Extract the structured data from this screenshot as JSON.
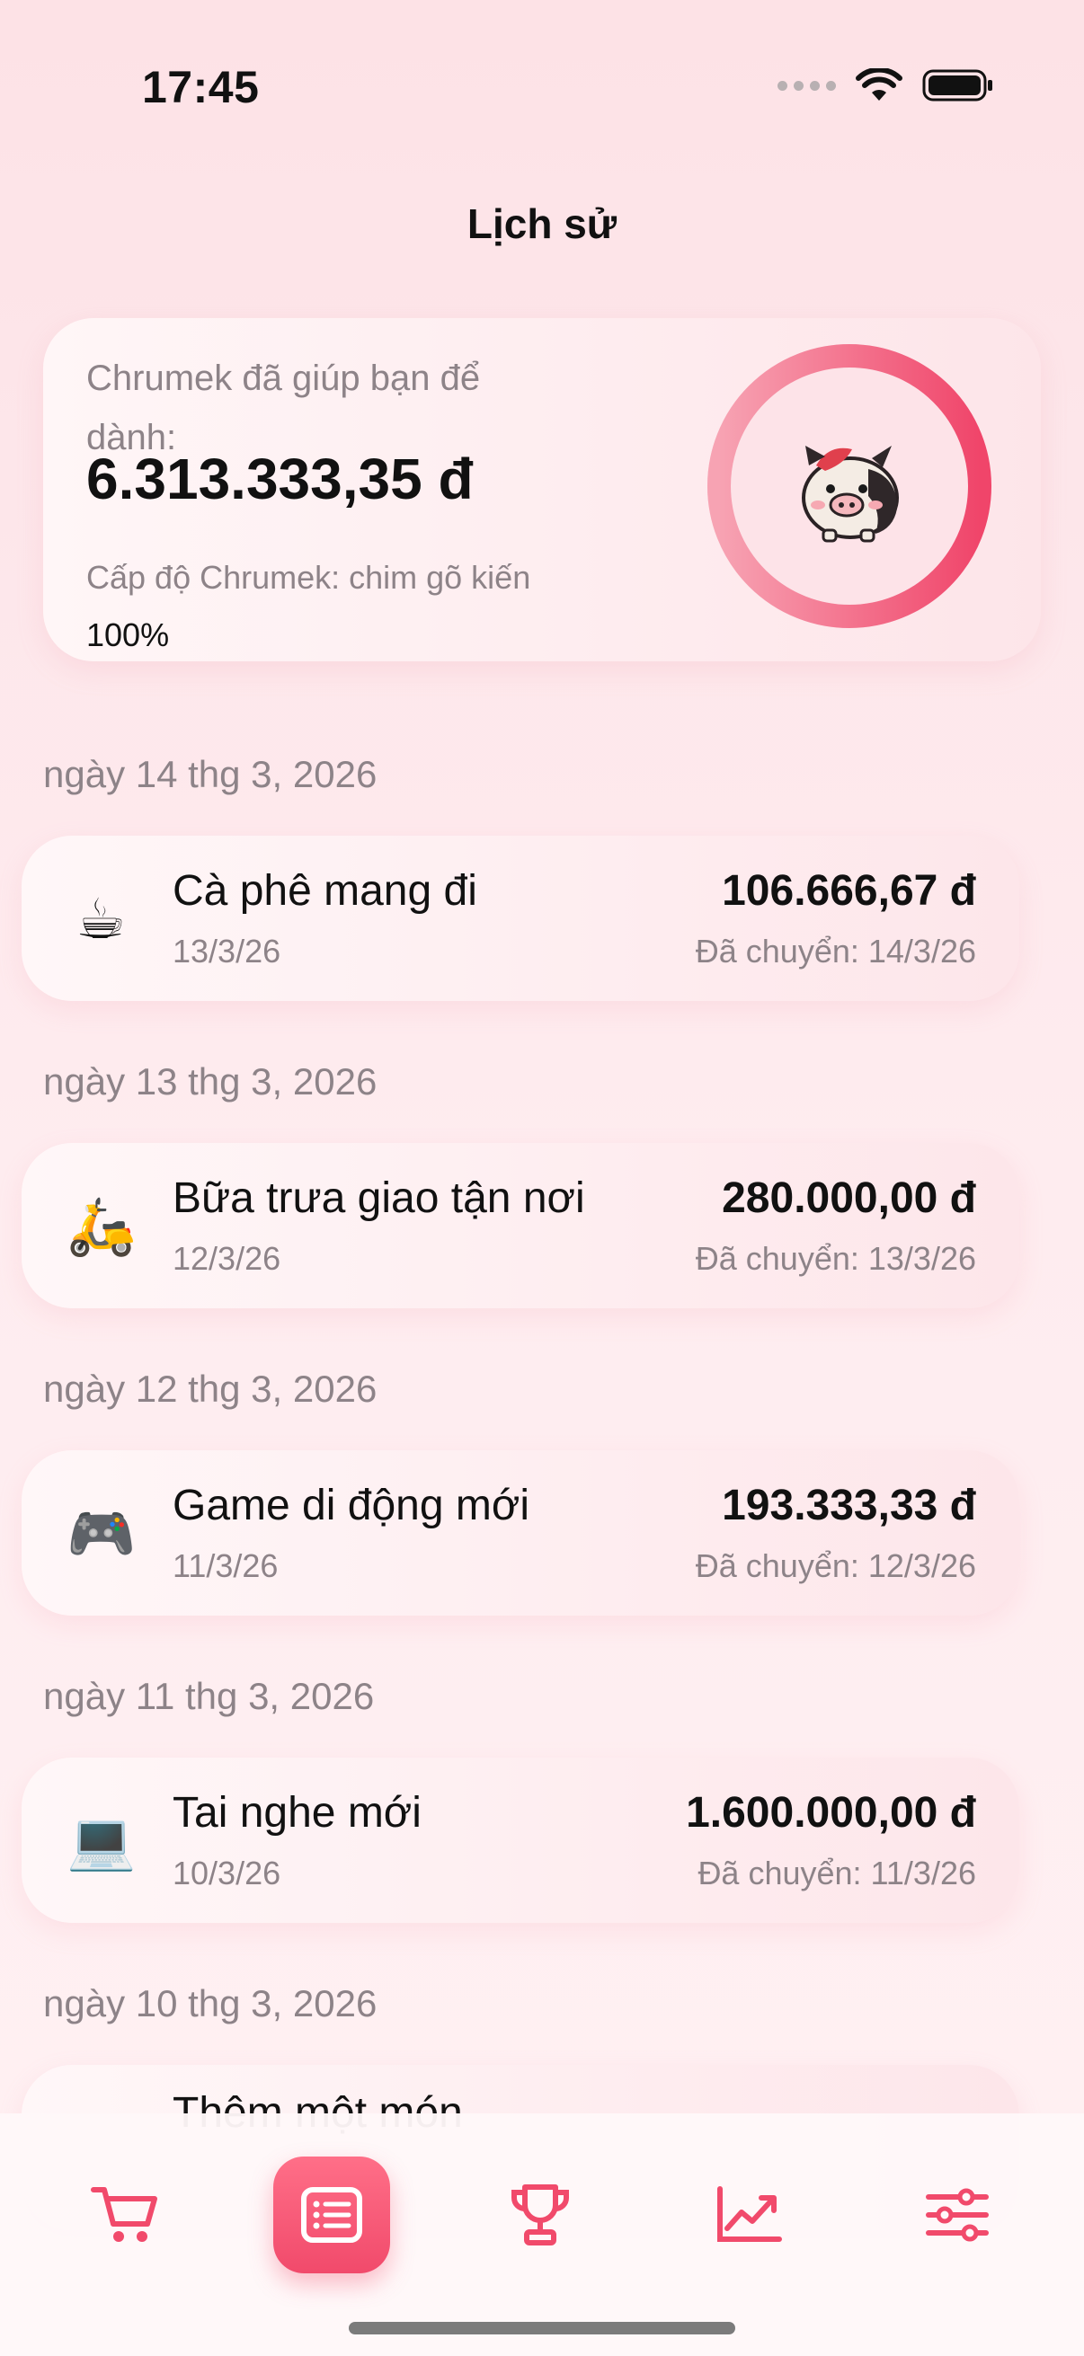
{
  "status_bar": {
    "time": "17:45"
  },
  "header": {
    "title": "Lịch sử"
  },
  "summary": {
    "caption": "Chrumek đã giúp bạn để dành:",
    "amount": "6.313.333,35 đ",
    "level": "Cấp độ Chrumek: chim gõ kiến",
    "percent": "100%",
    "progress": 1.0
  },
  "history": [
    {
      "date": "ngày 14 thg 3, 2026",
      "icon": "coffee-icon",
      "emoji": "☕",
      "title": "Cà phê mang đi",
      "created": "13/3/26",
      "amount": "106.666,67 đ",
      "transfer": "Đã chuyển: 14/3/26"
    },
    {
      "date": "ngày 13 thg 3, 2026",
      "icon": "scooter-icon",
      "emoji": "🛵",
      "title": "Bữa trưa giao tận nơi",
      "created": "12/3/26",
      "amount": "280.000,00 đ",
      "transfer": "Đã chuyển: 13/3/26"
    },
    {
      "date": "ngày 12 thg 3, 2026",
      "icon": "gamepad-icon",
      "emoji": "🎮",
      "title": "Game di động mới",
      "created": "11/3/26",
      "amount": "193.333,33 đ",
      "transfer": "Đã chuyển: 12/3/26"
    },
    {
      "date": "ngày 11 thg 3, 2026",
      "icon": "laptop-icon",
      "emoji": "💻",
      "title": "Tai nghe mới",
      "created": "10/3/26",
      "amount": "1.600.000,00 đ",
      "transfer": "Đã chuyển: 11/3/26"
    },
    {
      "date": "ngày 10 thg 3, 2026",
      "title_partial": "Thêm một món"
    }
  ],
  "tabs": [
    {
      "name": "cart",
      "icon": "cart-icon",
      "active": false
    },
    {
      "name": "history",
      "icon": "list-icon",
      "active": true
    },
    {
      "name": "achievements",
      "icon": "trophy-icon",
      "active": false
    },
    {
      "name": "stats",
      "icon": "chart-icon",
      "active": false
    },
    {
      "name": "settings",
      "icon": "sliders-icon",
      "active": false
    }
  ],
  "colors": {
    "accent": "#f14a6b",
    "ring_start": "#f7a3b3",
    "ring_end": "#f0456a",
    "muted_text": "#8d8388"
  }
}
